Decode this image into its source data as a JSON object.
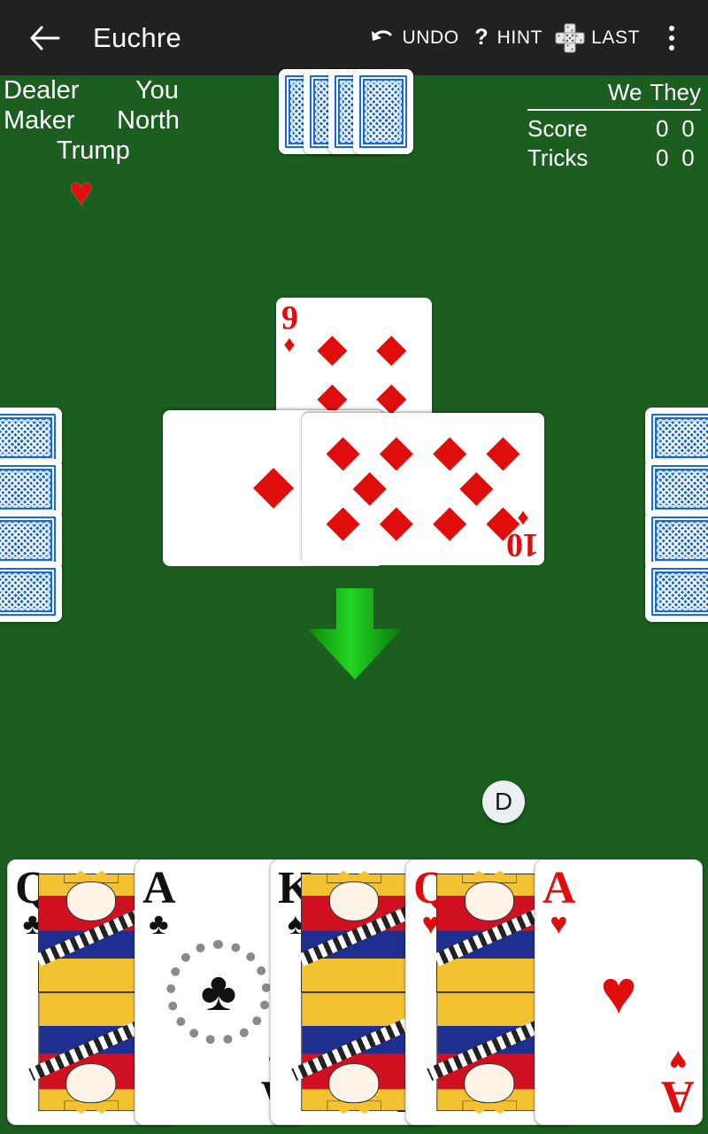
{
  "app": {
    "title": "Euchre",
    "bar_bg": "#212121",
    "table_bg": "#1b5e20"
  },
  "toolbar": {
    "back_icon": "back-arrow-icon",
    "actions": [
      {
        "id": "undo",
        "label": "UNDO",
        "icon": "undo-arrow-icon"
      },
      {
        "id": "hint",
        "label": "HINT",
        "icon": "question-mark-icon"
      },
      {
        "id": "last",
        "label": "LAST",
        "icon": "last-trick-cards-icon"
      }
    ],
    "overflow_icon": "more-vertical-icon"
  },
  "info": {
    "dealer_label": "Dealer",
    "dealer_value": "You",
    "maker_label": "Maker",
    "maker_value": "North",
    "trump_label": "Trump",
    "trump_suit": "hearts",
    "trump_glyph": "♥",
    "trump_color": "#e01010"
  },
  "score": {
    "col_we": "We",
    "col_they": "They",
    "rows": [
      {
        "label": "Score",
        "we": "0",
        "they": "0"
      },
      {
        "label": "Tricks",
        "we": "0",
        "they": "0"
      }
    ]
  },
  "hands": {
    "north": {
      "count": 4,
      "face_down": true
    },
    "west": {
      "count": 4,
      "face_down": true
    },
    "east": {
      "count": 4,
      "face_down": true
    },
    "player": {
      "cards": [
        {
          "rank": "Q",
          "suit": "clubs",
          "glyph": "♣",
          "color": "black",
          "type": "court"
        },
        {
          "rank": "A",
          "suit": "clubs",
          "glyph": "♣",
          "color": "black",
          "type": "ace"
        },
        {
          "rank": "K",
          "suit": "spades",
          "glyph": "♠",
          "color": "black",
          "type": "court"
        },
        {
          "rank": "Q",
          "suit": "hearts",
          "glyph": "♥",
          "color": "red",
          "type": "court"
        },
        {
          "rank": "A",
          "suit": "hearts",
          "glyph": "♥",
          "color": "red",
          "type": "ace"
        }
      ]
    }
  },
  "trick": {
    "cards": [
      {
        "player": "north",
        "rank": "9",
        "suit": "diamonds",
        "glyph": "♦",
        "color": "red",
        "rotated": false
      },
      {
        "player": "west",
        "rank": "A",
        "suit": "diamonds",
        "glyph": "♦",
        "color": "red",
        "rotated": true
      },
      {
        "player": "east",
        "rank": "10",
        "suit": "diamonds",
        "glyph": "♦",
        "color": "red",
        "rotated": true
      }
    ]
  },
  "indicators": {
    "turn_arrow": {
      "direction": "down",
      "target": "player",
      "color": "#16b016"
    },
    "dealer_chip": {
      "label": "D",
      "owner": "player"
    }
  }
}
